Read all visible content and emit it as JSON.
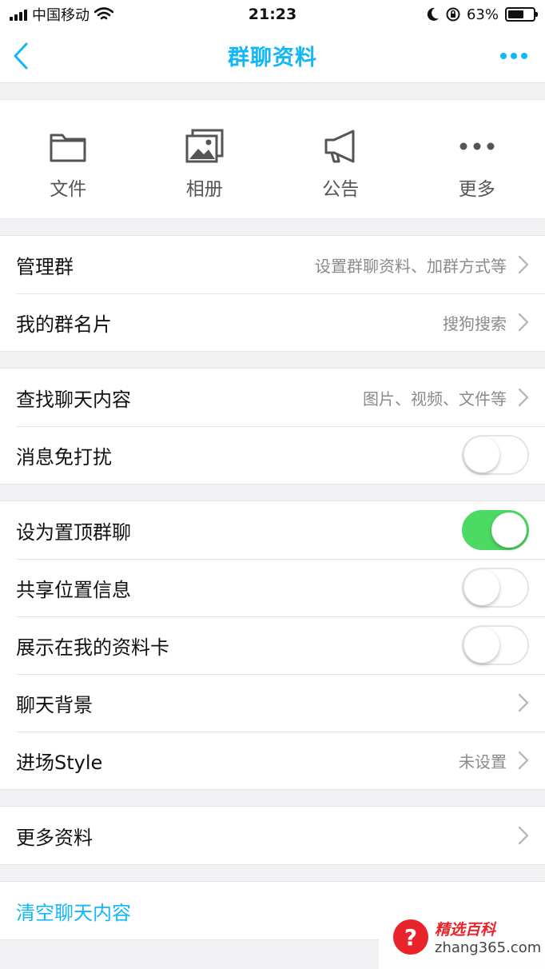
{
  "status_bar": {
    "carrier": "中国移动",
    "time": "21:23",
    "battery_percent": "63%",
    "battery_level": 0.63
  },
  "nav": {
    "title": "群聊资料",
    "back_icon": "chevron-left-icon",
    "more_icon": "ellipsis-icon"
  },
  "quick_actions": [
    {
      "label": "文件",
      "icon": "folder-icon"
    },
    {
      "label": "相册",
      "icon": "photo-album-icon"
    },
    {
      "label": "公告",
      "icon": "megaphone-icon"
    },
    {
      "label": "更多",
      "icon": "ellipsis-icon"
    }
  ],
  "group1": {
    "manage": {
      "title": "管理群",
      "detail": "设置群聊资料、加群方式等"
    },
    "card": {
      "title": "我的群名片",
      "detail": "搜狗搜索"
    }
  },
  "group2": {
    "search": {
      "title": "查找聊天内容",
      "detail": "图片、视频、文件等"
    },
    "mute": {
      "title": "消息免打扰",
      "on": false
    }
  },
  "group3": {
    "pin": {
      "title": "设为置顶群聊",
      "on": true
    },
    "location": {
      "title": "共享位置信息",
      "on": false
    },
    "show_card": {
      "title": "展示在我的资料卡",
      "on": false
    },
    "background": {
      "title": "聊天背景"
    },
    "entry_style": {
      "title": "进场Style",
      "detail": "未设置"
    }
  },
  "group4": {
    "more_info": {
      "title": "更多资料"
    }
  },
  "group5": {
    "clear": {
      "title": "清空聊天内容"
    }
  },
  "watermark": {
    "title": "精选百科",
    "url": "zhang365.com"
  },
  "colors": {
    "accent": "#12b7f5",
    "switch_on": "#4cd964",
    "watermark_red": "#e8242a"
  }
}
